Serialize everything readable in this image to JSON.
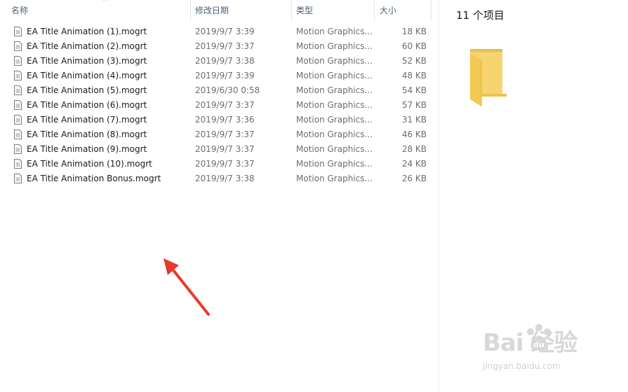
{
  "columns": {
    "name": "名称",
    "date": "修改日期",
    "type": "类型",
    "size": "大小"
  },
  "files": [
    {
      "name": "EA Title Animation (1).mogrt",
      "date": "2019/9/7 3:39",
      "type": "Motion Graphics...",
      "size": "18 KB"
    },
    {
      "name": "EA Title Animation (2).mogrt",
      "date": "2019/9/7 3:37",
      "type": "Motion Graphics...",
      "size": "60 KB"
    },
    {
      "name": "EA Title Animation (3).mogrt",
      "date": "2019/9/7 3:38",
      "type": "Motion Graphics...",
      "size": "52 KB"
    },
    {
      "name": "EA Title Animation (4).mogrt",
      "date": "2019/9/7 3:39",
      "type": "Motion Graphics...",
      "size": "48 KB"
    },
    {
      "name": "EA Title Animation (5).mogrt",
      "date": "2019/6/30 0:58",
      "type": "Motion Graphics...",
      "size": "54 KB"
    },
    {
      "name": "EA Title Animation (6).mogrt",
      "date": "2019/9/7 3:37",
      "type": "Motion Graphics...",
      "size": "57 KB"
    },
    {
      "name": "EA Title Animation (7).mogrt",
      "date": "2019/9/7 3:36",
      "type": "Motion Graphics...",
      "size": "31 KB"
    },
    {
      "name": "EA Title Animation (8).mogrt",
      "date": "2019/9/7 3:37",
      "type": "Motion Graphics...",
      "size": "46 KB"
    },
    {
      "name": "EA Title Animation (9).mogrt",
      "date": "2019/9/7 3:37",
      "type": "Motion Graphics...",
      "size": "28 KB"
    },
    {
      "name": "EA Title Animation (10).mogrt",
      "date": "2019/9/7 3:37",
      "type": "Motion Graphics...",
      "size": "24 KB"
    },
    {
      "name": "EA Title Animation Bonus.mogrt",
      "date": "2019/9/7 3:38",
      "type": "Motion Graphics...",
      "size": "26 KB"
    }
  ],
  "details": {
    "item_count": "11 个项目"
  },
  "watermark": {
    "logo": "Bai  经验",
    "sub": "jingyan.baidu.com"
  },
  "icons": {
    "file": "file-icon",
    "folder": "folder-icon",
    "sort": "sort-up-icon"
  },
  "colors": {
    "header_text": "#4c607a",
    "secondary_text": "#6d6d6d",
    "folder_yellow": "#f5cf62",
    "arrow_red": "#e8382e"
  }
}
